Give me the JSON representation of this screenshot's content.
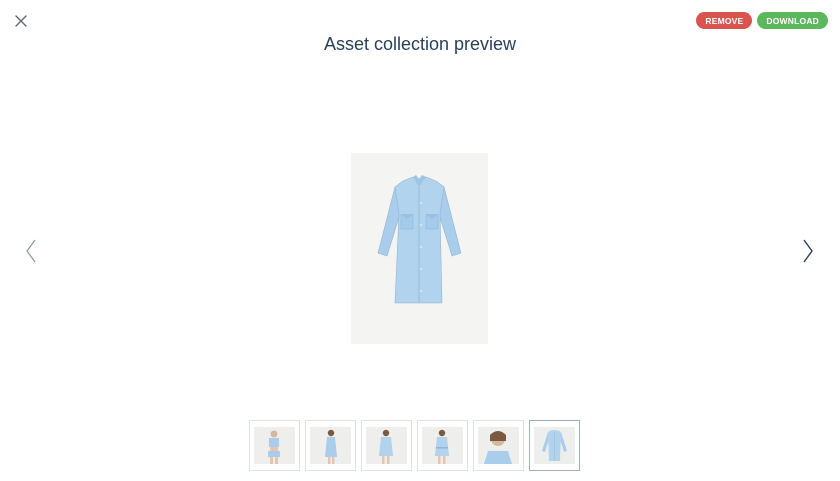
{
  "header": {
    "title": "Asset collection preview",
    "close_icon": "close-icon"
  },
  "actions": {
    "remove_label": "REMOVE",
    "download_label": "DOWNLOAD",
    "remove_color": "#d9534f",
    "download_color": "#5cb85c"
  },
  "navigation": {
    "prev_icon": "chevron-left-icon",
    "next_icon": "chevron-right-icon"
  },
  "preview": {
    "image": "denim-shirt-dress-front",
    "accent_color": "#a9cdea"
  },
  "thumbnails": [
    {
      "image": "model-crop-top-shorts"
    },
    {
      "image": "model-side-view-dress"
    },
    {
      "image": "model-front-dress"
    },
    {
      "image": "model-front-dress-belt"
    },
    {
      "image": "model-closeup-portrait"
    },
    {
      "image": "denim-shirt-dress-flat",
      "selected": true
    }
  ]
}
